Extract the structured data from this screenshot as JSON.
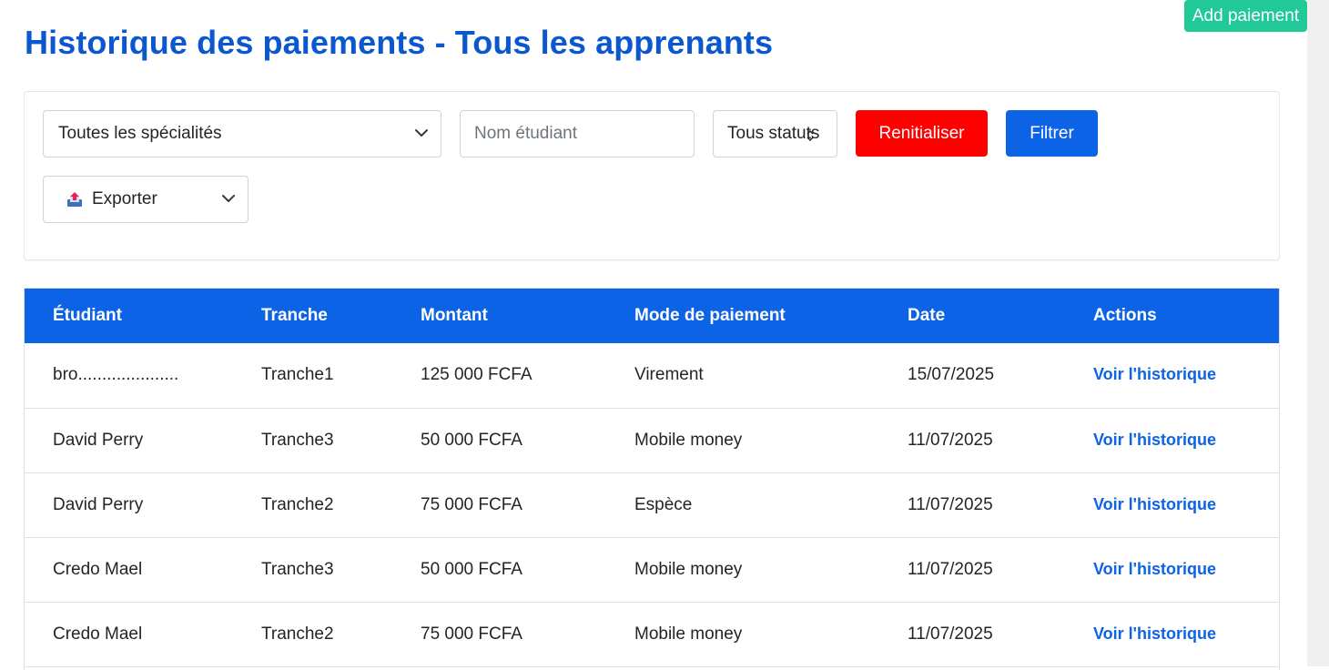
{
  "header": {
    "title": "Historique des paiements - Tous les apprenants",
    "add_button": "Add paiement"
  },
  "filters": {
    "specialty_selected": "Toutes les spécialités",
    "name_placeholder": "Nom étudiant",
    "name_value": "",
    "status_selected": "Tous statuts",
    "reset_label": "Renitialiser",
    "filter_label": "Filtrer",
    "export_label": "Exporter"
  },
  "table": {
    "columns": [
      "Étudiant",
      "Tranche",
      "Montant",
      "Mode de paiement",
      "Date",
      "Actions"
    ],
    "rows": [
      {
        "student": "bro.....................",
        "tranche": "Tranche1",
        "amount": "125 000 FCFA",
        "mode": "Virement",
        "date": "15/07/2025",
        "action": "Voir l'historique"
      },
      {
        "student": "David Perry",
        "tranche": "Tranche3",
        "amount": "50 000 FCFA",
        "mode": "Mobile money",
        "date": "11/07/2025",
        "action": "Voir l'historique"
      },
      {
        "student": "David Perry",
        "tranche": "Tranche2",
        "amount": "75 000 FCFA",
        "mode": "Espèce",
        "date": "11/07/2025",
        "action": "Voir l'historique"
      },
      {
        "student": "Credo Mael",
        "tranche": "Tranche3",
        "amount": "50 000 FCFA",
        "mode": "Mobile money",
        "date": "11/07/2025",
        "action": "Voir l'historique"
      },
      {
        "student": "Credo Mael",
        "tranche": "Tranche2",
        "amount": "75 000 FCFA",
        "mode": "Mobile money",
        "date": "11/07/2025",
        "action": "Voir l'historique"
      }
    ]
  },
  "colors": {
    "title": "#0b57d0",
    "primary": "#0d63e5",
    "danger": "#ff0000",
    "success": "#20c997"
  },
  "icons": {
    "export": "export-icon",
    "chevron": "chevron-down-icon"
  }
}
